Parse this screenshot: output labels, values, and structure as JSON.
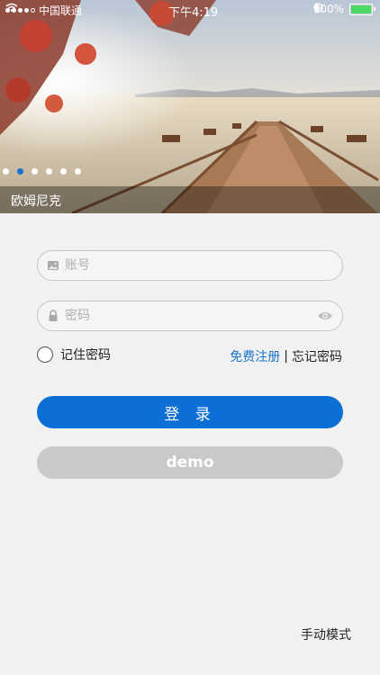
{
  "status_bar": {
    "carrier": "中国联通",
    "time": "下午4:19",
    "battery_percent": "100%",
    "battery_level": 1.0,
    "signal_bars_filled": 4,
    "signal_bars_total": 5,
    "icons": [
      "wifi-icon",
      "orientation-lock-icon",
      "bluetooth-icon",
      "battery-icon",
      "charging-icon"
    ]
  },
  "banner": {
    "caption": "欧姆尼克",
    "slide_count": 6,
    "active_slide": 2
  },
  "login_form": {
    "account_placeholder": "账号",
    "password_placeholder": "密码",
    "remember_label": "记住密码",
    "register_link": "免费注册",
    "separator": "|",
    "forgot_link": "忘记密码",
    "login_button": "登 录",
    "demo_button": "demo"
  },
  "footer": {
    "manual_mode": "手动模式"
  },
  "colors": {
    "accent": "#0c6fd5",
    "link": "#1a73c8",
    "demo_bg": "#c9c9c9",
    "page_bg": "#f1f1f1"
  }
}
